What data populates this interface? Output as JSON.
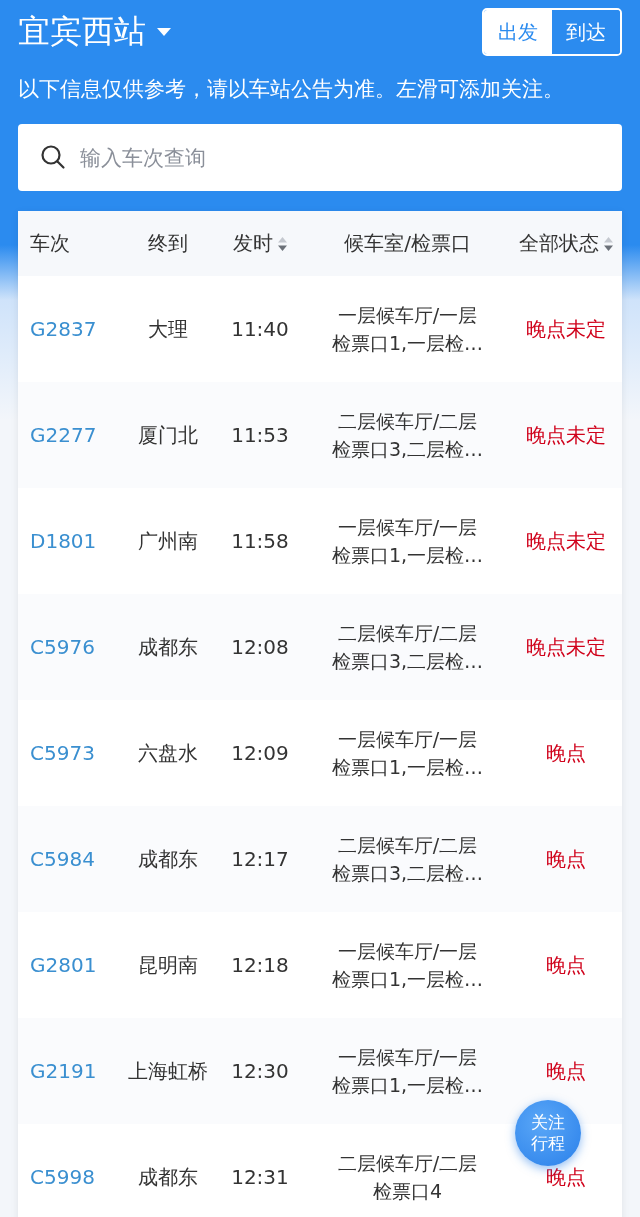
{
  "station": {
    "name": "宜宾西站"
  },
  "mode_toggle": [
    {
      "label": "出发",
      "selected": true
    },
    {
      "label": "到达",
      "selected": false
    }
  ],
  "notice": "以下信息仅供参考，请以车站公告为准。左滑可添加关注。",
  "search": {
    "placeholder": "输入车次查询"
  },
  "table": {
    "columns": [
      {
        "label": "车次",
        "sortable": false
      },
      {
        "label": "终到",
        "sortable": false
      },
      {
        "label": "发时",
        "sortable": true
      },
      {
        "label": "候车室/检票口",
        "sortable": false
      },
      {
        "label": "全部状态",
        "sortable": true
      }
    ],
    "rows": [
      {
        "train": "G2837",
        "destination": "大理",
        "departs": "11:40",
        "waiting_area": "一层候车厅/一层检票口1,一层检…",
        "status": "晚点未定"
      },
      {
        "train": "G2277",
        "destination": "厦门北",
        "departs": "11:53",
        "waiting_area": "二层候车厅/二层检票口3,二层检…",
        "status": "晚点未定"
      },
      {
        "train": "D1801",
        "destination": "广州南",
        "departs": "11:58",
        "waiting_area": "一层候车厅/一层检票口1,一层检…",
        "status": "晚点未定"
      },
      {
        "train": "C5976",
        "destination": "成都东",
        "departs": "12:08",
        "waiting_area": "二层候车厅/二层检票口3,二层检…",
        "status": "晚点未定"
      },
      {
        "train": "C5973",
        "destination": "六盘水",
        "departs": "12:09",
        "waiting_area": "一层候车厅/一层检票口1,一层检…",
        "status": "晚点"
      },
      {
        "train": "C5984",
        "destination": "成都东",
        "departs": "12:17",
        "waiting_area": "二层候车厅/二层检票口3,二层检…",
        "status": "晚点"
      },
      {
        "train": "G2801",
        "destination": "昆明南",
        "departs": "12:18",
        "waiting_area": "一层候车厅/一层检票口1,一层检…",
        "status": "晚点"
      },
      {
        "train": "G2191",
        "destination": "上海虹桥",
        "departs": "12:30",
        "waiting_area": "一层候车厅/一层检票口1,一层检…",
        "status": "晚点"
      },
      {
        "train": "C5998",
        "destination": "成都东",
        "departs": "12:31",
        "waiting_area": "二层候车厅/二层检票口4",
        "status": "晚点"
      }
    ]
  },
  "follow_button": {
    "label": "关注行程"
  }
}
